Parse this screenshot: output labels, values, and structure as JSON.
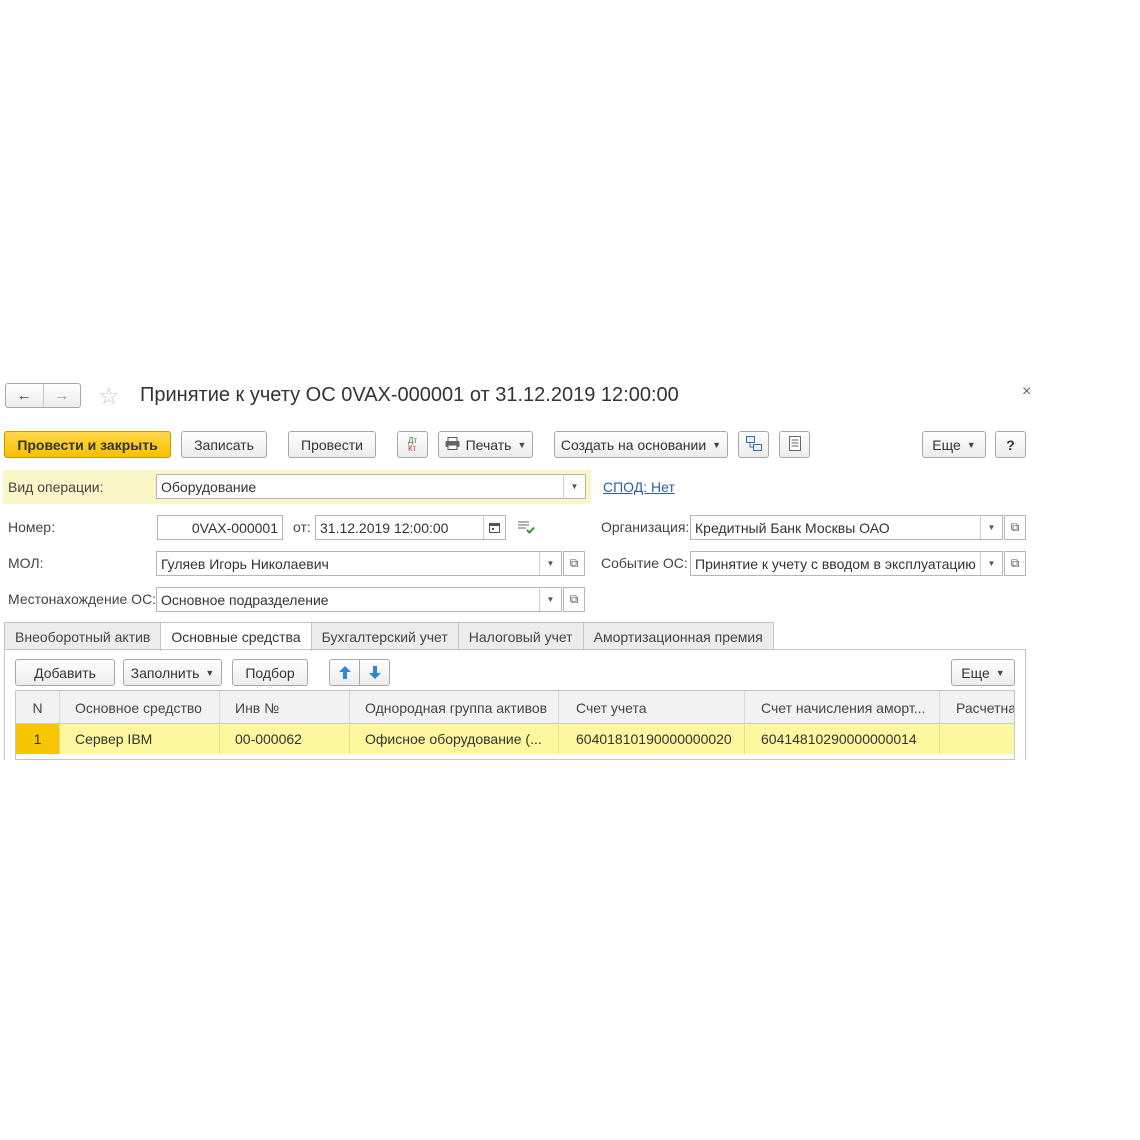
{
  "window": {
    "title": "Принятие к учету ОС 0VAX-000001 от 31.12.2019 12:00:00",
    "back_glyph": "←",
    "forward_glyph": "→",
    "star_glyph": "☆",
    "close_glyph": "×"
  },
  "toolbar": {
    "post_close": "Провести и закрыть",
    "save": "Записать",
    "post": "Провести",
    "dtkt_top": "Дт",
    "dtkt_bottom": "Кт",
    "print": "Печать",
    "create_based": "Создать на основании",
    "more": "Еще",
    "help": "?"
  },
  "form": {
    "operation_label": "Вид операции:",
    "operation_value": "Оборудование",
    "spod_link": "СПОД: Нет",
    "number_label": "Номер:",
    "number_value": "0VAX-000001",
    "date_label": "от:",
    "date_value": "31.12.2019 12:00:00",
    "org_label": "Организация:",
    "org_value": "Кредитный Банк Москвы ОАО",
    "mol_label": "МОЛ:",
    "mol_value": "Гуляев Игорь Николаевич",
    "event_label": "Событие ОС:",
    "event_value": "Принятие к учету с вводом в эксплуатацию",
    "location_label": "Местонахождение ОС:",
    "location_value": "Основное подразделение"
  },
  "tabs": [
    {
      "label": "Внеоборотный актив",
      "active": false
    },
    {
      "label": "Основные средства",
      "active": true
    },
    {
      "label": "Бухгалтерский учет",
      "active": false
    },
    {
      "label": "Налоговый учет",
      "active": false
    },
    {
      "label": "Амортизационная премия",
      "active": false
    }
  ],
  "table_toolbar": {
    "add": "Добавить",
    "fill": "Заполнить",
    "pick": "Подбор",
    "up_glyph": "🡅",
    "down_glyph": "🡇",
    "more": "Еще"
  },
  "table": {
    "columns": [
      "N",
      "Основное средство",
      "Инв №",
      "Однородная группа активов",
      "Счет учета",
      "Счет начисления аморт...",
      "Расчетна"
    ],
    "rows": [
      [
        "1",
        "Сервер IBM",
        "00-000062",
        "Офисное оборудование (...",
        "60401810190000000020",
        "60414810290000000014",
        ""
      ]
    ]
  },
  "colors": {
    "accent_yellow": "#f7c000",
    "row_highlight": "#fdf79e",
    "link_blue": "#2a5ea8"
  }
}
